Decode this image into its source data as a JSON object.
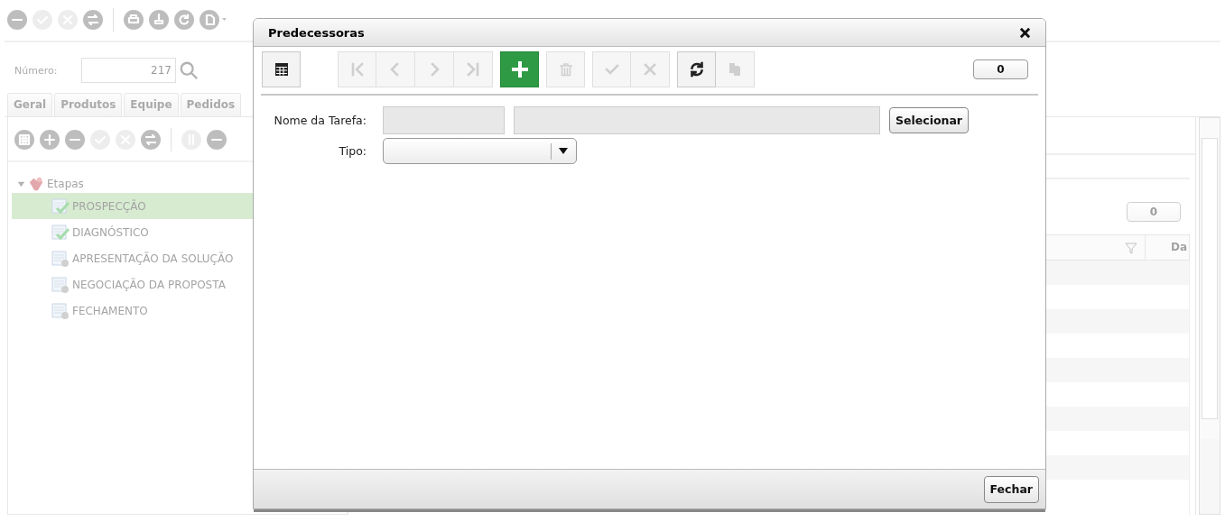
{
  "app": {
    "toolbar": [
      {
        "kind": "minus",
        "disabled": false
      },
      {
        "kind": "check",
        "disabled": true
      },
      {
        "kind": "cancel",
        "disabled": true
      },
      {
        "kind": "swap",
        "disabled": false
      },
      {
        "kind": "separator"
      },
      {
        "kind": "print",
        "disabled": false
      },
      {
        "kind": "stamp",
        "disabled": false
      },
      {
        "kind": "refresh",
        "disabled": false
      },
      {
        "kind": "export",
        "disabled": false
      }
    ],
    "number_field": {
      "label": "Número:",
      "value": "217"
    },
    "tabs": [
      {
        "label": "Geral",
        "selected": false
      },
      {
        "label": "Produtos",
        "selected": false
      },
      {
        "label": "Equipe",
        "selected": false
      },
      {
        "label": "Pedidos",
        "selected": false
      }
    ],
    "tree_toolbar": [
      {
        "kind": "grid",
        "disabled": false
      },
      {
        "kind": "plus",
        "disabled": false
      },
      {
        "kind": "minus",
        "disabled": false
      },
      {
        "kind": "check",
        "disabled": true
      },
      {
        "kind": "cancel",
        "disabled": true
      },
      {
        "kind": "swap",
        "disabled": false
      },
      {
        "kind": "separator"
      },
      {
        "kind": "sort",
        "disabled": true
      },
      {
        "kind": "minus",
        "disabled": false
      }
    ],
    "tree": [
      {
        "label": "Etapas",
        "expanded": true,
        "children": [
          {
            "label": "PROSPECÇÃO",
            "done": true,
            "selected": true
          },
          {
            "label": "DIAGNÓSTICO",
            "done": true,
            "selected": false
          },
          {
            "label": "APRESENTAÇÃO DA SOLUÇÃO",
            "done": false,
            "selected": false
          },
          {
            "label": "NEGOCIAÇÃO DA PROPOSTA",
            "done": false,
            "selected": false
          },
          {
            "label": "FECHAMENTO",
            "done": false,
            "selected": false
          }
        ]
      }
    ],
    "counter": "0",
    "grid": {
      "columns": [
        "Da"
      ]
    }
  },
  "dialog": {
    "title": "Predecessoras",
    "toolbar": [
      [
        {
          "kind": "grid",
          "disabled": false
        }
      ],
      [
        {
          "kind": "first",
          "disabled": true
        },
        {
          "kind": "prev",
          "disabled": true
        },
        {
          "kind": "next",
          "disabled": true
        },
        {
          "kind": "last",
          "disabled": true
        }
      ],
      [
        {
          "kind": "add",
          "disabled": false
        }
      ],
      [
        {
          "kind": "delete",
          "disabled": true
        }
      ],
      [
        {
          "kind": "confirm",
          "disabled": true
        },
        {
          "kind": "cancel",
          "disabled": true
        }
      ],
      [
        {
          "kind": "refresh",
          "disabled": false
        },
        {
          "kind": "copy",
          "disabled": true
        }
      ]
    ],
    "counter": "0",
    "fields": [
      {
        "kind": "lookup",
        "label": "Nome da Tarefa:",
        "disabled": true,
        "button": "Selecionar"
      },
      {
        "kind": "select",
        "label": "Tipo:"
      }
    ],
    "buttons": [
      "Fechar"
    ]
  }
}
